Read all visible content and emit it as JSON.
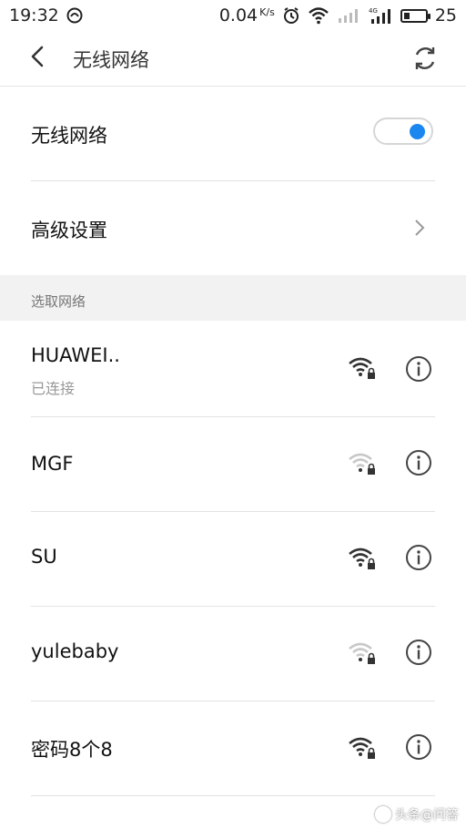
{
  "status_bar": {
    "time": "19:32",
    "speed": "0.04",
    "speed_unit": "K/s",
    "battery": "25",
    "network_label": "4G"
  },
  "app_bar": {
    "title": "无线网络"
  },
  "wifi_toggle": {
    "label": "无线网络",
    "on": true,
    "accent": "#1a86f0"
  },
  "advanced": {
    "label": "高级设置"
  },
  "section": {
    "label": "选取网络"
  },
  "networks": [
    {
      "name": "HUAWEI..",
      "status": "已连接",
      "signal": "strong"
    },
    {
      "name": "MGF",
      "status": "",
      "signal": "weak"
    },
    {
      "name": "SU",
      "status": "",
      "signal": "strong"
    },
    {
      "name": "yulebaby",
      "status": "",
      "signal": "weak"
    },
    {
      "name": "密码8个8",
      "status": "",
      "signal": "strong"
    }
  ],
  "watermark": {
    "text": "头条@问答"
  }
}
